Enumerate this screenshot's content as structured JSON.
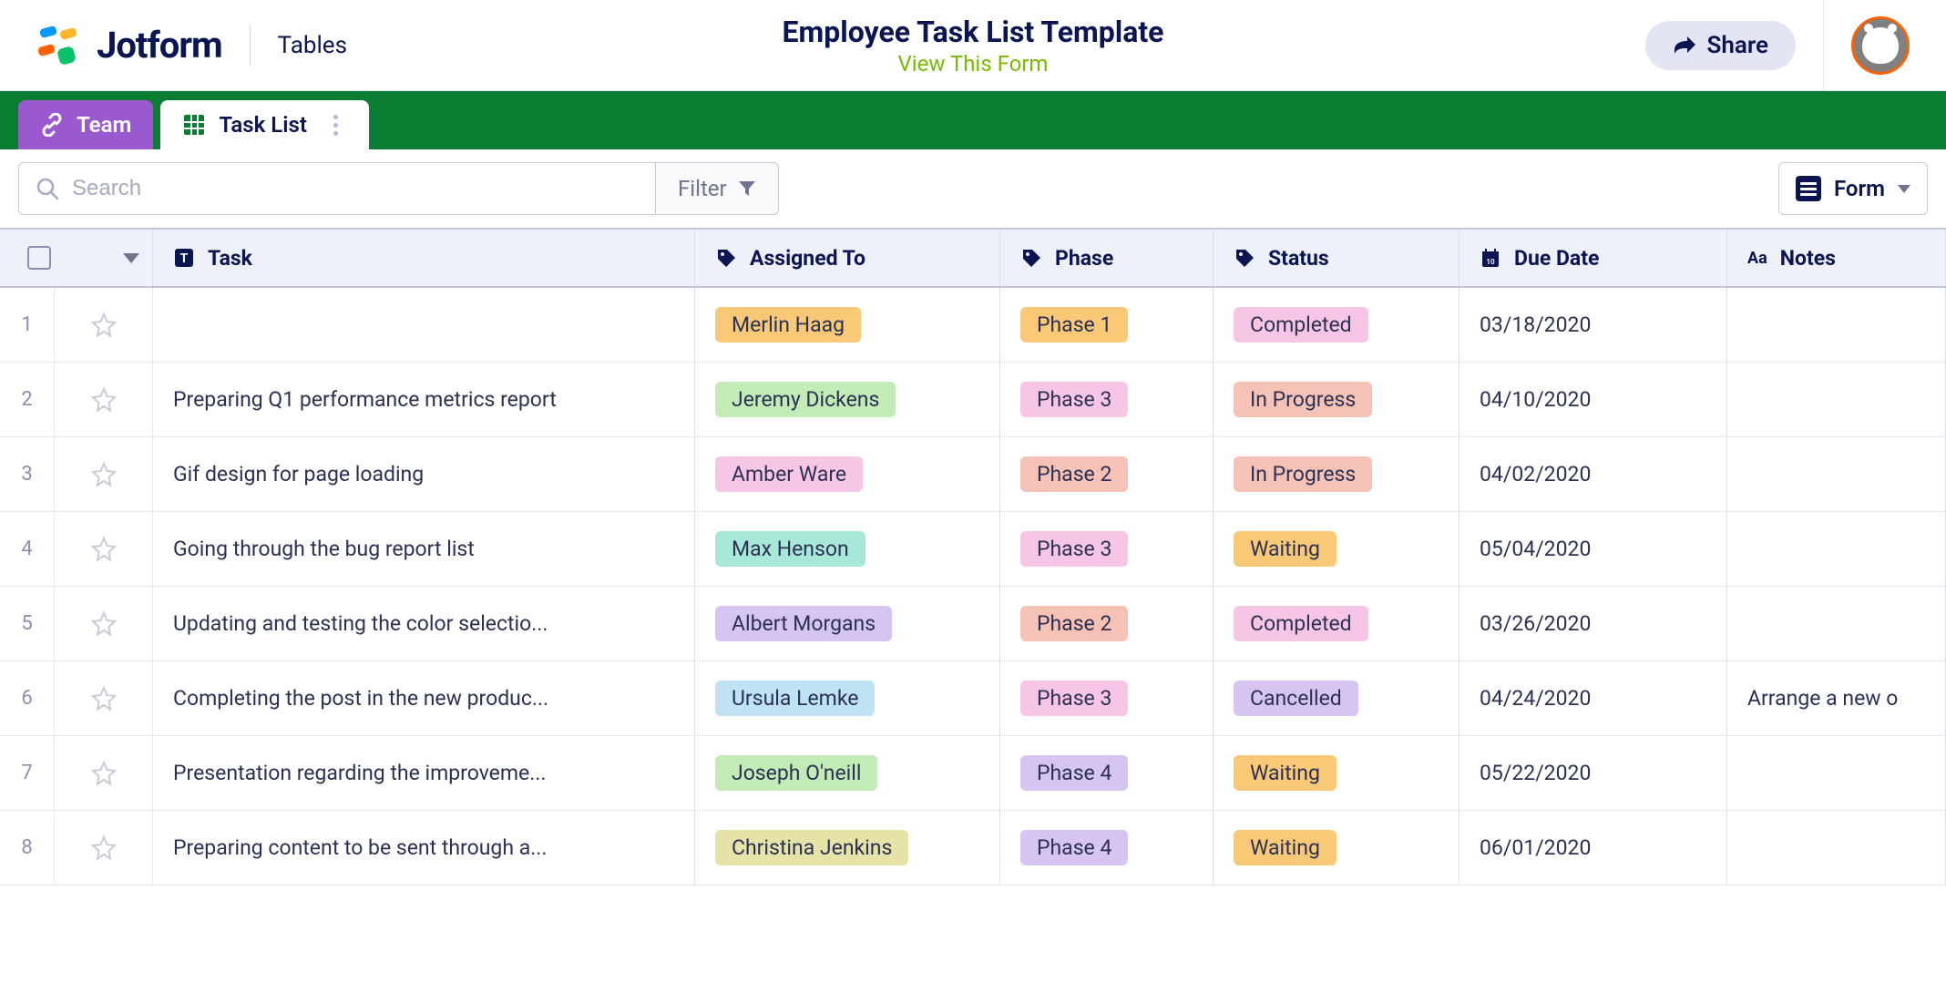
{
  "header": {
    "logo_text": "Jotform",
    "section": "Tables",
    "title": "Employee Task List Template",
    "view_link": "View This Form",
    "share_label": "Share"
  },
  "tabs": {
    "team": "Team",
    "task_list": "Task List"
  },
  "toolbar": {
    "search_placeholder": "Search",
    "filter_label": "Filter",
    "form_label": "Form"
  },
  "columns": {
    "task": "Task",
    "assigned": "Assigned To",
    "phase": "Phase",
    "status": "Status",
    "due_date": "Due Date",
    "notes": "Notes"
  },
  "tag_colors": {
    "assignee": {
      "Merlin Haag": "#f9c978",
      "Jeremy Dickens": "#c3ebb5",
      "Amber Ware": "#f7c6e6",
      "Max Henson": "#a7e8d8",
      "Albert Morgans": "#d6c5f2",
      "Ursula Lemke": "#bfe3f5",
      "Joseph O'neill": "#c3ebb5",
      "Christina Jenkins": "#e6e3a8"
    },
    "phase": {
      "Phase 1": "#f9c978",
      "Phase 2": "#f5c2b5",
      "Phase 3": "#f7c6e6",
      "Phase 4": "#d6c5f2"
    },
    "status": {
      "Completed": "#f7c6e6",
      "In Progress": "#f5c2b5",
      "Waiting": "#f9c978",
      "Cancelled": "#d6c5f2"
    }
  },
  "rows": [
    {
      "num": "1",
      "task": "",
      "assignee": "Merlin Haag",
      "phase": "Phase 1",
      "status": "Completed",
      "due": "03/18/2020",
      "notes": ""
    },
    {
      "num": "2",
      "task": "Preparing Q1 performance metrics report",
      "assignee": "Jeremy Dickens",
      "phase": "Phase 3",
      "status": "In Progress",
      "due": "04/10/2020",
      "notes": ""
    },
    {
      "num": "3",
      "task": "Gif design for page loading",
      "assignee": "Amber Ware",
      "phase": "Phase 2",
      "status": "In Progress",
      "due": "04/02/2020",
      "notes": ""
    },
    {
      "num": "4",
      "task": "Going through the bug report list",
      "assignee": "Max Henson",
      "phase": "Phase 3",
      "status": "Waiting",
      "due": "05/04/2020",
      "notes": ""
    },
    {
      "num": "5",
      "task": "Updating and testing the color selectio...",
      "assignee": "Albert Morgans",
      "phase": "Phase 2",
      "status": "Completed",
      "due": "03/26/2020",
      "notes": ""
    },
    {
      "num": "6",
      "task": "Completing the post in the new produc...",
      "assignee": "Ursula Lemke",
      "phase": "Phase 3",
      "status": "Cancelled",
      "due": "04/24/2020",
      "notes": "Arrange a new o"
    },
    {
      "num": "7",
      "task": "Presentation regarding the improveme...",
      "assignee": "Joseph O'neill",
      "phase": "Phase 4",
      "status": "Waiting",
      "due": "05/22/2020",
      "notes": ""
    },
    {
      "num": "8",
      "task": "Preparing content to be sent through a...",
      "assignee": "Christina Jenkins",
      "phase": "Phase 4",
      "status": "Waiting",
      "due": "06/01/2020",
      "notes": ""
    }
  ]
}
